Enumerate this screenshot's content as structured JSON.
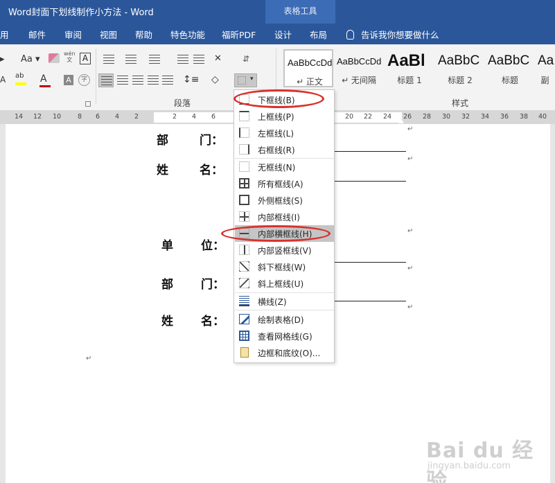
{
  "titlebar": {
    "title": "Word封面下划线制作小方法  -  Word",
    "context_group": "表格工具"
  },
  "ribbon_tabs": [
    "用",
    "邮件",
    "审阅",
    "视图",
    "帮助",
    "特色功能",
    "福昕PDF",
    "设计",
    "布局"
  ],
  "tell_me": "告诉我你想要做什么",
  "groups": {
    "paragraph": "段落",
    "styles": "样式"
  },
  "font_controls": {
    "case_label": "Aa",
    "phonetic_top": "wén",
    "phonetic_bottom": "文",
    "boxed_char": "A",
    "shade_char": "A",
    "circle_char": "字"
  },
  "styles": [
    {
      "sample": "AaBbCcDd",
      "name": "↵ 正文",
      "selected": true
    },
    {
      "sample": "AaBbCcDd",
      "name": "↵ 无间隔",
      "selected": false
    },
    {
      "sample": "AaBl",
      "name": "标题 1",
      "selected": false
    },
    {
      "sample": "AaBbC",
      "name": "标题 2",
      "selected": false
    },
    {
      "sample": "AaBbC",
      "name": "标题",
      "selected": false
    },
    {
      "sample": "Aa",
      "name": "副",
      "selected": false
    }
  ],
  "ruler": {
    "left_numbers": [
      "14",
      "12",
      "10",
      "8",
      "6",
      "4",
      "2"
    ],
    "right_numbers": [
      "2",
      "4",
      "6"
    ],
    "far_numbers": [
      "20",
      "22",
      "24",
      "26",
      "28",
      "30",
      "32",
      "34",
      "36",
      "38",
      "40"
    ]
  },
  "document": {
    "rows": [
      {
        "label_a": "部",
        "label_b": "门："
      },
      {
        "label_a": "姓",
        "label_b": "名："
      },
      {
        "label_a": "单",
        "label_b": "位："
      },
      {
        "label_a": "部",
        "label_b": "门："
      },
      {
        "label_a": "姓",
        "label_b": "名："
      }
    ],
    "para_mark": "↵"
  },
  "borders_menu": [
    {
      "label": "下框线(B)",
      "icon": "bottom-border-icon"
    },
    {
      "label": "上框线(P)",
      "icon": "top-border-icon"
    },
    {
      "label": "左框线(L)",
      "icon": "left-border-icon"
    },
    {
      "label": "右框线(R)",
      "icon": "right-border-icon"
    },
    {
      "label": "无框线(N)",
      "icon": "no-border-icon"
    },
    {
      "label": "所有框线(A)",
      "icon": "all-borders-icon"
    },
    {
      "label": "外侧框线(S)",
      "icon": "outside-borders-icon"
    },
    {
      "label": "内部框线(I)",
      "icon": "inside-borders-icon"
    },
    {
      "label": "内部横框线(H)",
      "icon": "inside-horizontal-border-icon",
      "highlighted": true
    },
    {
      "label": "内部竖框线(V)",
      "icon": "inside-vertical-border-icon"
    },
    {
      "label": "斜下框线(W)",
      "icon": "diagonal-down-border-icon"
    },
    {
      "label": "斜上框线(U)",
      "icon": "diagonal-up-border-icon"
    },
    {
      "label": "横线(Z)",
      "icon": "horizontal-line-icon"
    },
    {
      "label": "绘制表格(D)",
      "icon": "draw-table-icon"
    },
    {
      "label": "查看网格线(G)",
      "icon": "view-gridlines-icon"
    },
    {
      "label": "边框和底纹(O)...",
      "icon": "borders-shading-icon"
    }
  ],
  "watermark": {
    "logo": "Bai du 经验",
    "sub": "jingyan.baidu.com"
  },
  "colors": {
    "title_bar": "#2b579a",
    "context_tab": "#3d6cb6",
    "annotation_red": "#d9312c",
    "font_color_red": "#c00000",
    "highlight_yellow": "#ffff00"
  }
}
